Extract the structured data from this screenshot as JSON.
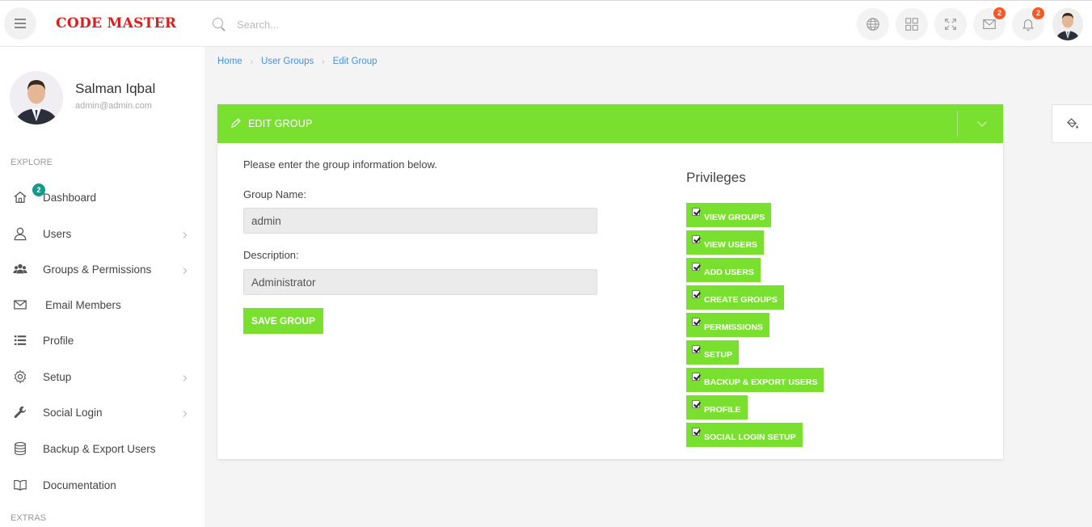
{
  "brand": "CODE MASTER",
  "search": {
    "placeholder": "Search..."
  },
  "topbar": {
    "icons": [
      "hamburger-icon",
      "globe-icon",
      "grid-icon",
      "fullscreen-icon",
      "mail-icon",
      "bell-icon"
    ],
    "mail_badge": "2",
    "bell_badge": "2"
  },
  "user": {
    "name": "Salman Iqbal",
    "email": "admin@admin.com"
  },
  "sidebar": {
    "explore_label": "EXPLORE",
    "extras_label": "EXTRAS",
    "items": [
      {
        "label": "Dashboard",
        "icon": "home-icon",
        "badge": "2"
      },
      {
        "label": "Users",
        "icon": "user-icon",
        "has_children": true
      },
      {
        "label": "Groups & Permissions",
        "icon": "users-icon",
        "has_children": true
      },
      {
        "label": "Email Members",
        "icon": "mail-icon"
      },
      {
        "label": "Profile",
        "icon": "list-icon"
      },
      {
        "label": "Setup",
        "icon": "gear-icon",
        "has_children": true
      },
      {
        "label": "Social Login",
        "icon": "wrench-icon",
        "has_children": true
      },
      {
        "label": "Backup & Export Users",
        "icon": "database-icon"
      },
      {
        "label": "Documentation",
        "icon": "book-icon"
      }
    ]
  },
  "breadcrumb": [
    "Home",
    "User Groups",
    "Edit Group"
  ],
  "card": {
    "title": "EDIT GROUP",
    "intro": "Please enter the group information below.",
    "group_name_label": "Group Name:",
    "group_name_value": "admin",
    "description_label": "Description:",
    "description_value": "Administrator",
    "save_label": "SAVE GROUP",
    "privileges_title": "Privileges",
    "privileges": [
      {
        "label": "VIEW GROUPS",
        "checked": true
      },
      {
        "label": "VIEW USERS",
        "checked": true
      },
      {
        "label": "ADD USERS",
        "checked": true
      },
      {
        "label": "CREATE GROUPS",
        "checked": true
      },
      {
        "label": "PERMISSIONS",
        "checked": true
      },
      {
        "label": "SETUP",
        "checked": true
      },
      {
        "label": "BACKUP & EXPORT USERS",
        "checked": true
      },
      {
        "label": "PROFILE",
        "checked": true
      },
      {
        "label": "SOCIAL LOGIN SETUP",
        "checked": true
      }
    ]
  },
  "colors": {
    "accent": "#7ae030",
    "brand": "#e01b1b",
    "badge": "#ff5722",
    "teal_badge": "#159a8a",
    "link": "#4a90d9"
  }
}
